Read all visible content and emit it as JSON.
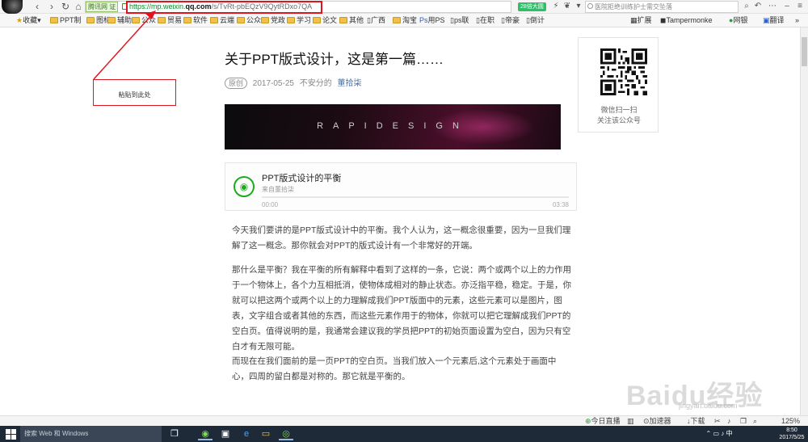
{
  "browser": {
    "cert_badge": "腾讯网 证",
    "url_scheme": "https://mp.weixin.",
    "url_host": "qq.com",
    "url_path": "/s/TvRt-pbEQzV9QytRDxo7QA",
    "speed_badge": "28倍大圆",
    "search_placeholder": "医院拒绝训练护士需交坠落"
  },
  "bookmarks": [
    {
      "label": "收藏",
      "icon": "star-icon"
    },
    {
      "label": "PPT制",
      "icon": "folder-icon"
    },
    {
      "label": "图标",
      "icon": "folder-icon"
    },
    {
      "label": "辅助",
      "icon": "folder-icon"
    },
    {
      "label": "公众",
      "icon": "folder-icon"
    },
    {
      "label": "贸易",
      "icon": "folder-icon"
    },
    {
      "label": "软件",
      "icon": "folder-icon"
    },
    {
      "label": "云端",
      "icon": "folder-icon"
    },
    {
      "label": "公众",
      "icon": "folder-icon"
    },
    {
      "label": "党政",
      "icon": "folder-icon"
    },
    {
      "label": "学习",
      "icon": "folder-icon"
    },
    {
      "label": "论文",
      "icon": "folder-icon"
    },
    {
      "label": "其他",
      "icon": "folder-icon"
    },
    {
      "label": "广西",
      "icon": "page-icon"
    },
    {
      "label": "淘宝",
      "icon": "folder-icon"
    },
    {
      "label": "用PS",
      "icon": "page-icon"
    },
    {
      "label": "ps联",
      "icon": "page-icon"
    },
    {
      "label": "在职",
      "icon": "page-icon"
    },
    {
      "label": "帝豪",
      "icon": "page-icon"
    },
    {
      "label": "倒计",
      "icon": "page-icon"
    }
  ],
  "bookmarks_right": {
    "extensions": "扩展",
    "tampermonkey": "Tampermonke",
    "bank": "网银",
    "translate": "翻译"
  },
  "annotation": {
    "note": "粘贴到此处"
  },
  "article": {
    "title": "关于PPT版式设计，这是第一篇……",
    "tag": "原创",
    "date": "2017-05-25",
    "author": "不安分的",
    "account": "董拾柒",
    "banner_text": "RAPIDESIGN",
    "audio": {
      "title": "PPT版式设计的平衡",
      "source": "来自董拾柒",
      "current_time": "00:00",
      "duration": "03:38",
      "progress": 0
    },
    "paragraphs": [
      "今天我们要讲的是PPT版式设计中的平衡。我个人认为，这一概念很重要，因为一旦我们理解了这一概念。那你就会对PPT的版式设计有一个非常好的开端。",
      "那什么是平衡？我在平衡的所有解释中看到了这样的一条，它说：两个或两个以上的力作用于一个物体上，各个力互相抵消，使物体成相对的静止状态。亦泛指平稳，稳定。于是，你就可以把这两个或两个以上的力理解成我们PPT版面中的元素，这些元素可以是图片，图表，文字组合或者其他的东西，而这些元素作用于的物体，你就可以把它理解成我们PPT的空白页。值得说明的是，我通常会建议我的学员把PPT的初始页面设置为空白，因为只有空白才有无限可能。",
      "而现在在我们面前的是一页PPT的空白页。当我们放入一个元素后,这个元素处于画面中心，四周的留白都是对称的。那它就是平衡的。"
    ]
  },
  "qr_panel": {
    "caption_line1": "微信扫一扫",
    "caption_line2": "关注该公众号"
  },
  "statusbar": {
    "live": "今日直播",
    "accelerator": "加速器",
    "download": "下载",
    "zoom": "125%"
  },
  "taskbar": {
    "search_placeholder": "搜索 Web 和 Windows",
    "time": "8:50",
    "date": "2017/5/25"
  },
  "watermark": {
    "brand": "Baidu经验",
    "url": "jingyan.baidu.com"
  }
}
